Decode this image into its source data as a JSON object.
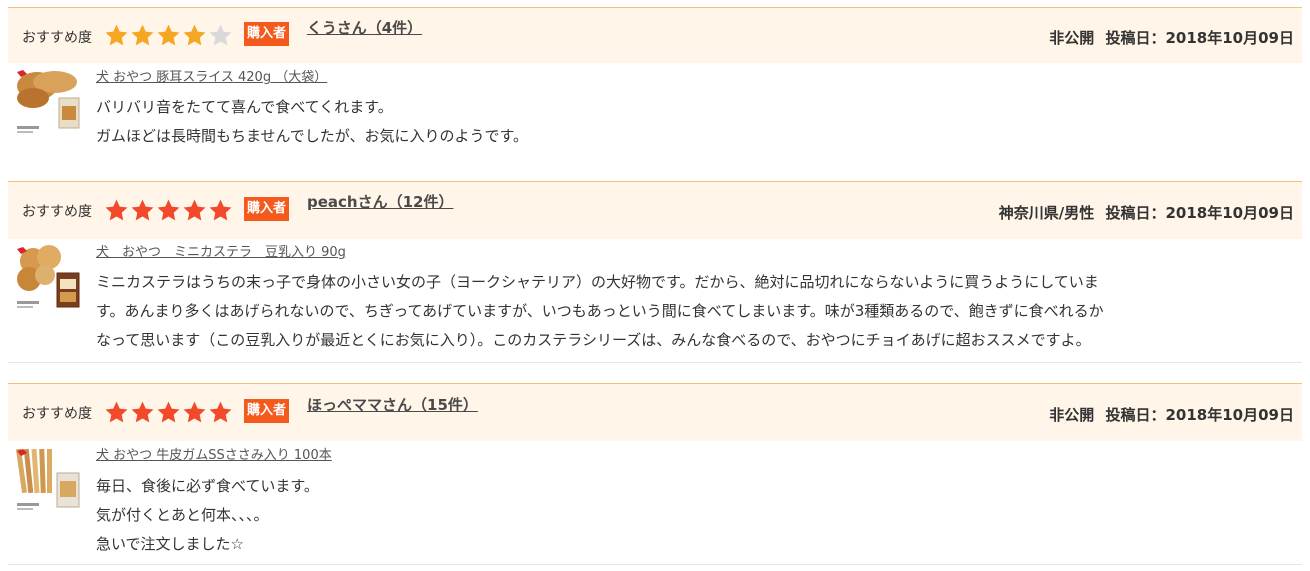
{
  "reviews": [
    {
      "recommend_label": "おすすめ度",
      "rating": 4,
      "max_rating": 5,
      "badge": "購入者",
      "reviewer": "くうさん（4件）",
      "location": "非公開",
      "posted_label": "投稿日：2018年10月09日",
      "product_name": "犬 おやつ 豚耳スライス 420g （大袋）",
      "body": [
        "バリバリ音をたてて喜んで食べてくれます。",
        "ガムほどは長時間もちませんでしたが、お気に入りのようです。"
      ]
    },
    {
      "recommend_label": "おすすめ度",
      "rating": 5,
      "max_rating": 5,
      "badge": "購入者",
      "reviewer": "peachさん（12件）",
      "location": "神奈川県/男性",
      "posted_label": "投稿日：2018年10月09日",
      "product_name": "犬　おやつ　ミニカステラ　豆乳入り 90g",
      "body": [
        "ミニカステラはうちの末っ子で身体の小さい女の子（ヨークシャテリア）の大好物です。だから、絶対に品切れにならないように買うようにしていま",
        "す。あんまり多くはあげられないので、ちぎってあげていますが、いつもあっという間に食べてしまいます。味が3種類あるので、飽きずに食べれるか",
        "なって思います（この豆乳入りが最近とくにお気に入り）。このカステラシリーズは、みんな食べるので、おやつにチョイあげに超おススメですよ。"
      ]
    },
    {
      "recommend_label": "おすすめ度",
      "rating": 5,
      "max_rating": 5,
      "badge": "購入者",
      "reviewer": "ほっぺママさん（15件）",
      "location": "非公開",
      "posted_label": "投稿日：2018年10月09日",
      "product_name": "犬 おやつ 牛皮ガムSSささみ入り 100本",
      "body": [
        "毎日、食後に必ず食べています。",
        "気が付くとあと何本、、、。",
        "急いで注文しました☆"
      ]
    }
  ],
  "colors": {
    "star_filled": "#f5a623",
    "star_filled_red": "#f2492a",
    "star_empty": "#d9d9d9",
    "badge": "#f45a1c",
    "header_bg": "#fff5e8",
    "header_border": "#f0c27a"
  }
}
